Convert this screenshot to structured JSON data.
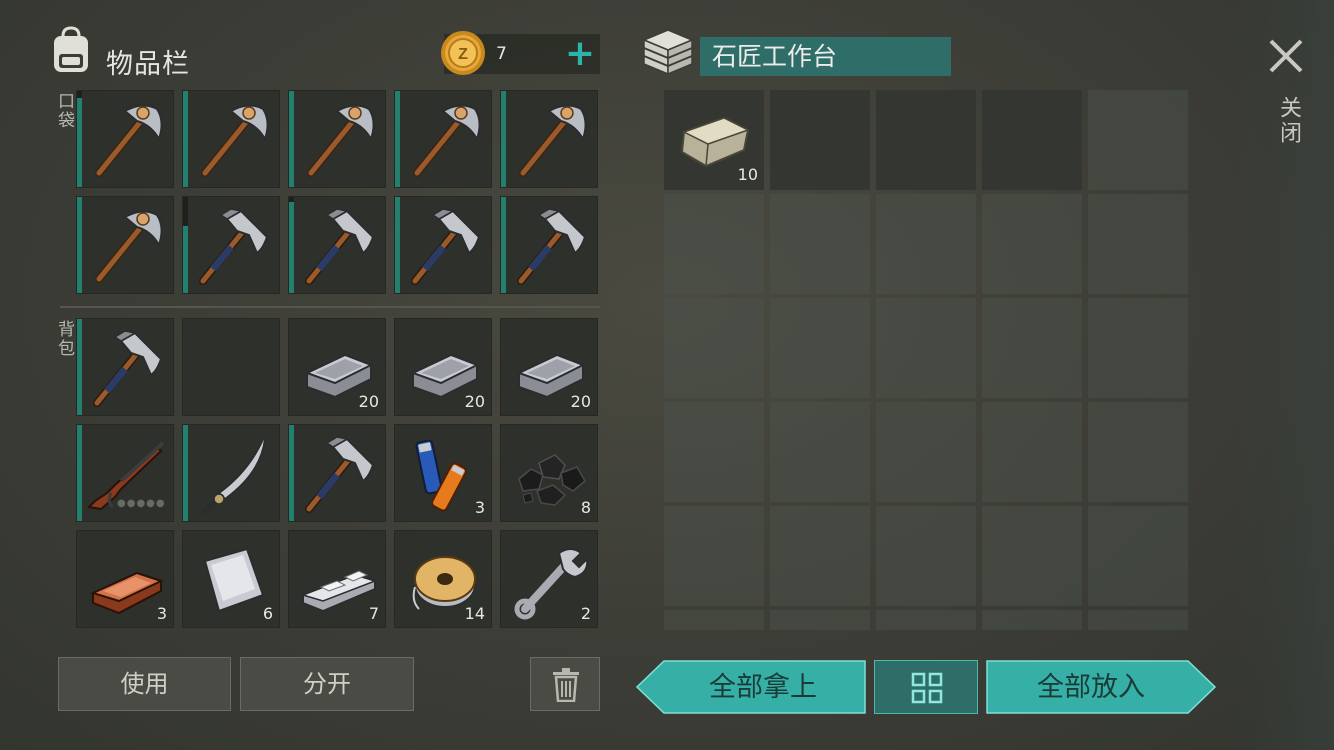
{
  "inventory": {
    "title": "物品栏",
    "coins": "7",
    "pocket_label": "口袋",
    "backpack_label": "背包",
    "use_label": "使用",
    "split_label": "分开"
  },
  "pocket_items": [
    {
      "name": "stone-pickaxe",
      "durability": 0.93
    },
    {
      "name": "stone-pickaxe",
      "durability": 1.0
    },
    {
      "name": "stone-pickaxe",
      "durability": 1.0
    },
    {
      "name": "stone-pickaxe",
      "durability": 1.0
    },
    {
      "name": "stone-pickaxe",
      "durability": 1.0
    },
    {
      "name": "stone-pickaxe",
      "durability": 1.0
    },
    {
      "name": "iron-pickaxe",
      "durability": 0.7
    },
    {
      "name": "iron-pickaxe",
      "durability": 0.95
    },
    {
      "name": "iron-pickaxe",
      "durability": 1.0
    },
    {
      "name": "iron-pickaxe",
      "durability": 1.0
    }
  ],
  "backpack_items": [
    {
      "name": "iron-pickaxe",
      "count": "",
      "durability": 1.0
    },
    {
      "name": "empty",
      "count": ""
    },
    {
      "name": "iron-ingot",
      "count": "20"
    },
    {
      "name": "iron-ingot",
      "count": "20"
    },
    {
      "name": "iron-ingot",
      "count": "20"
    },
    {
      "name": "rifle",
      "count": "",
      "durability": 1.0
    },
    {
      "name": "machete",
      "count": "",
      "durability": 1.0
    },
    {
      "name": "iron-pickaxe",
      "count": "",
      "durability": 1.0
    },
    {
      "name": "batteries",
      "count": "3"
    },
    {
      "name": "coal",
      "count": "8"
    },
    {
      "name": "copper-ingot",
      "count": "3"
    },
    {
      "name": "metal-sheet",
      "count": "6"
    },
    {
      "name": "aluminum-bars",
      "count": "7"
    },
    {
      "name": "wire-spool",
      "count": "14"
    },
    {
      "name": "wrench",
      "count": "2"
    }
  ],
  "workbench": {
    "title": "石匠工作台",
    "items": [
      {
        "name": "stone-block",
        "count": "10"
      }
    ],
    "take_all_label": "全部拿上",
    "put_all_label": "全部放入"
  },
  "close_label": "关闭",
  "colors": {
    "accent": "#2ab5a8",
    "teal_button": "#36b0a6",
    "title_bar": "#2f6e68",
    "durability": "#23806f"
  }
}
